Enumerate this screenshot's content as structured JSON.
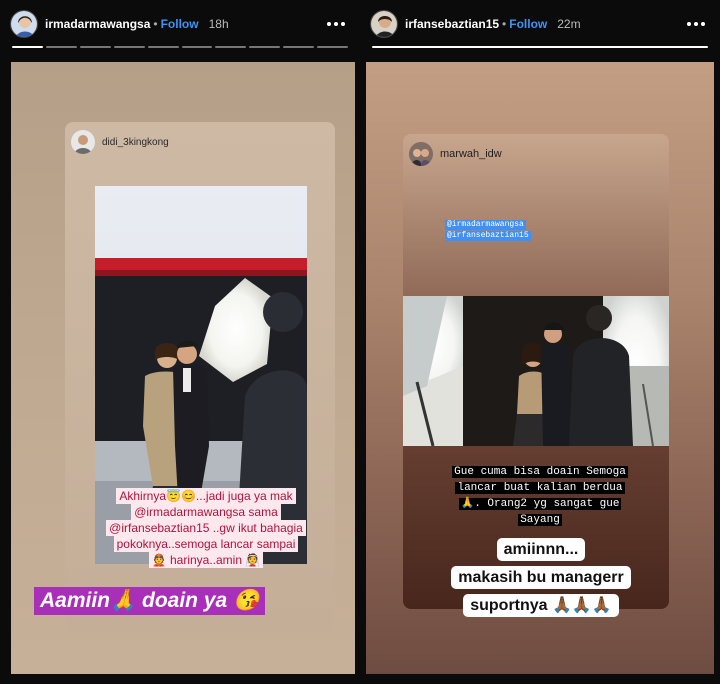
{
  "left_story": {
    "username": "irmadarmawangsa",
    "follow_label": "Follow",
    "separator": "•",
    "time": "18h",
    "progress_segments": 10,
    "progress_done": 1,
    "repost_user": "didi_3kingkong",
    "caption_lines": [
      "Akhirnya😇😊...jadi juga ya mak",
      "@irmadarmawangsa  sama",
      "@irfansebaztian15 ..gw ikut bahagia",
      "pokoknya..semoga lancar sampai",
      "👲 harinya..amin 👰"
    ],
    "big_tag": "Aamiin🙏 doain ya 😘",
    "colors": {
      "tag_bg": "#a830b8",
      "caption_text": "#b0123e",
      "caption_bg": "#fde8ee"
    }
  },
  "right_story": {
    "username": "irfansebaztian15",
    "follow_label": "Follow",
    "separator": "•",
    "time": "22m",
    "progress_segments": 1,
    "progress_done": 1,
    "repost_user": "marwah_idw",
    "mentions": [
      "@irmadarmawangsa",
      "@irfansebaztian15"
    ],
    "typewriter_lines": [
      "Gue cuma bisa doain Semoga",
      "lancar buat kalian berdua",
      "🙏. Orang2 yg sangat gue",
      "Sayang"
    ],
    "reply_lines": [
      "amiinnn...",
      "makasih bu managerr",
      "suportnya 🙏🏾🙏🏾🙏🏾"
    ]
  },
  "icons": {
    "more": "more-options-icon",
    "avatar": "avatar"
  },
  "accent_color": "#3d93f6"
}
